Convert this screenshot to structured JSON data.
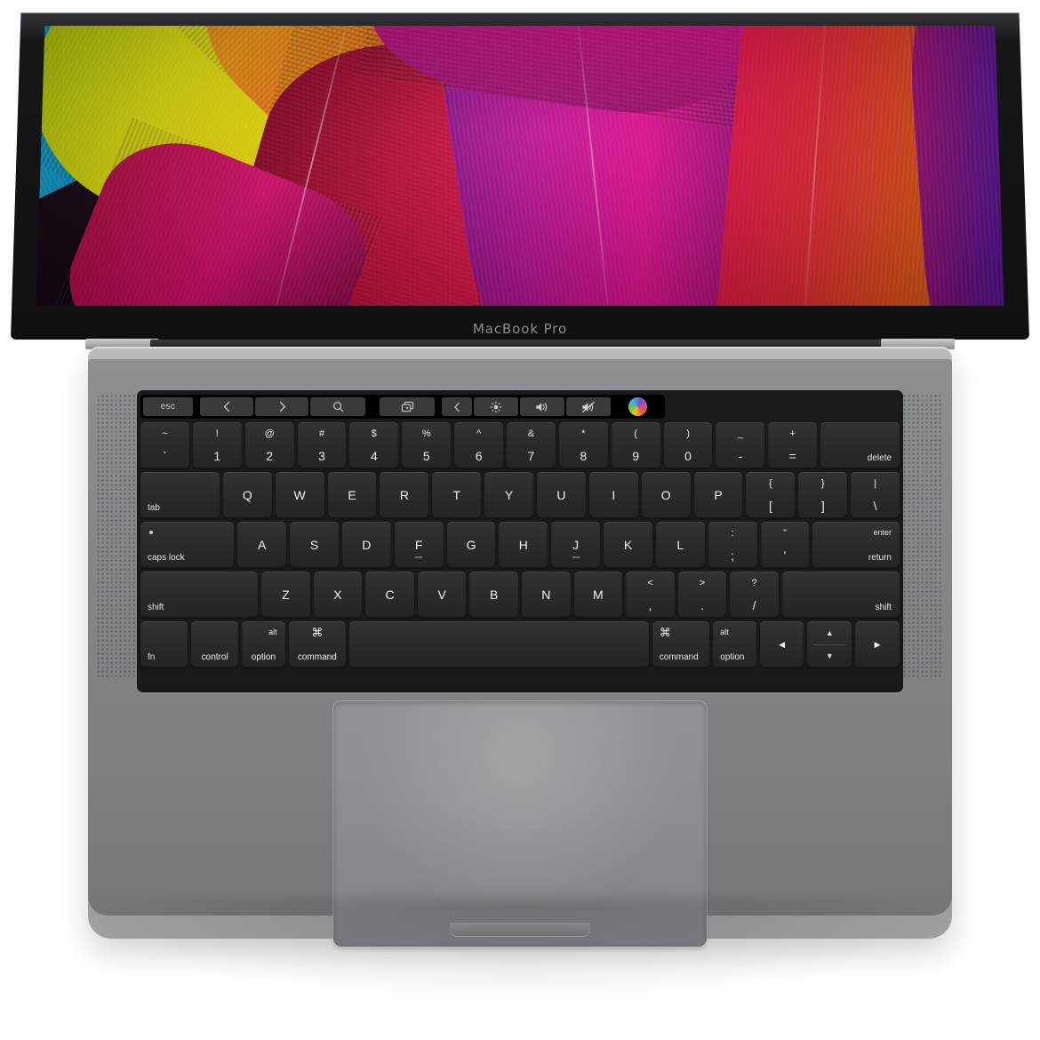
{
  "device": {
    "brand_label": "MacBook Pro",
    "finish_color": "#a8aaad",
    "keyboard_well_color": "#1a1a1c",
    "key_color": "#2b2b2d",
    "trackpad_color": "#8b8e92"
  },
  "screen": {
    "wallpaper_name": "colorful-ribbon-fibers-wallpaper",
    "palette": [
      "#14b4e6",
      "#f4e40c",
      "#f59a12",
      "#ef5a22",
      "#d9123f",
      "#e8117f",
      "#b3169b",
      "#6a1fa8"
    ]
  },
  "touchbar": {
    "esc_label": "esc",
    "back_icon": "chevron-left-icon",
    "forward_icon": "chevron-right-icon",
    "search_icon": "search-icon",
    "favorites_label": "safari-favorites-strip",
    "thumbnails": [
      "#e8453c",
      "#f2f2f4",
      "#e6e0d6",
      "#e9118b",
      "#f6f6f8",
      "#ffffff",
      "#2d2150",
      "#ffffff"
    ],
    "tabs_overview_icon": "window-tabs-icon",
    "expand_icon": "chevron-left-icon",
    "brightness_icon": "brightness-icon",
    "volume_icon": "volume-up-icon",
    "mute_icon": "volume-mute-icon",
    "siri_icon": "siri-color-wheel-icon"
  },
  "keyboard": {
    "rows": [
      {
        "name": "number-row",
        "keys": [
          {
            "name": "key-backtick",
            "top": "~",
            "bottom": "`",
            "style": "stacked",
            "width": "w-key"
          },
          {
            "name": "key-1",
            "top": "!",
            "bottom": "1",
            "style": "stacked",
            "width": "w-key"
          },
          {
            "name": "key-2",
            "top": "@",
            "bottom": "2",
            "style": "stacked",
            "width": "w-key"
          },
          {
            "name": "key-3",
            "top": "#",
            "bottom": "3",
            "style": "stacked",
            "width": "w-key"
          },
          {
            "name": "key-4",
            "top": "$",
            "bottom": "4",
            "style": "stacked",
            "width": "w-key"
          },
          {
            "name": "key-5",
            "top": "%",
            "bottom": "5",
            "style": "stacked",
            "width": "w-key"
          },
          {
            "name": "key-6",
            "top": "^",
            "bottom": "6",
            "style": "stacked",
            "width": "w-key"
          },
          {
            "name": "key-7",
            "top": "&",
            "bottom": "7",
            "style": "stacked",
            "width": "w-key"
          },
          {
            "name": "key-8",
            "top": "*",
            "bottom": "8",
            "style": "stacked",
            "width": "w-key"
          },
          {
            "name": "key-9",
            "top": "(",
            "bottom": "9",
            "style": "stacked",
            "width": "w-key"
          },
          {
            "name": "key-0",
            "top": ")",
            "bottom": "0",
            "style": "stacked",
            "width": "w-key"
          },
          {
            "name": "key-minus",
            "top": "_",
            "bottom": "-",
            "style": "stacked",
            "width": "w-key"
          },
          {
            "name": "key-equals",
            "top": "+",
            "bottom": "=",
            "style": "stacked",
            "width": "w-key"
          },
          {
            "name": "key-delete",
            "label": "delete",
            "style": "corner-br",
            "width": "w-del"
          }
        ]
      },
      {
        "name": "qwerty-row",
        "keys": [
          {
            "name": "key-tab",
            "label": "tab",
            "style": "corner-bl",
            "width": "w-tab"
          },
          {
            "name": "key-q",
            "label": "Q",
            "style": "single",
            "width": "w-key"
          },
          {
            "name": "key-w",
            "label": "W",
            "style": "single",
            "width": "w-key"
          },
          {
            "name": "key-e",
            "label": "E",
            "style": "single",
            "width": "w-key"
          },
          {
            "name": "key-r",
            "label": "R",
            "style": "single",
            "width": "w-key"
          },
          {
            "name": "key-t",
            "label": "T",
            "style": "single",
            "width": "w-key"
          },
          {
            "name": "key-y",
            "label": "Y",
            "style": "single",
            "width": "w-key"
          },
          {
            "name": "key-u",
            "label": "U",
            "style": "single",
            "width": "w-key"
          },
          {
            "name": "key-i",
            "label": "I",
            "style": "single",
            "width": "w-key"
          },
          {
            "name": "key-o",
            "label": "O",
            "style": "single",
            "width": "w-key"
          },
          {
            "name": "key-p",
            "label": "P",
            "style": "single",
            "width": "w-key"
          },
          {
            "name": "key-bracket-left",
            "top": "{",
            "bottom": "[",
            "style": "stacked",
            "width": "w-key"
          },
          {
            "name": "key-bracket-right",
            "top": "}",
            "bottom": "]",
            "style": "stacked",
            "width": "w-key"
          },
          {
            "name": "key-backslash",
            "top": "|",
            "bottom": "\\",
            "style": "stacked",
            "width": "w-key"
          }
        ]
      },
      {
        "name": "home-row",
        "keys": [
          {
            "name": "key-caps-lock",
            "label": "caps lock",
            "style": "caps",
            "width": "w-caps"
          },
          {
            "name": "key-a",
            "label": "A",
            "style": "single",
            "width": "w-key"
          },
          {
            "name": "key-s",
            "label": "S",
            "style": "single",
            "width": "w-key"
          },
          {
            "name": "key-d",
            "label": "D",
            "style": "single",
            "width": "w-key"
          },
          {
            "name": "key-f",
            "label": "F",
            "style": "single-bump",
            "width": "w-key"
          },
          {
            "name": "key-g",
            "label": "G",
            "style": "single",
            "width": "w-key"
          },
          {
            "name": "key-h",
            "label": "H",
            "style": "single",
            "width": "w-key"
          },
          {
            "name": "key-j",
            "label": "J",
            "style": "single-bump",
            "width": "w-key"
          },
          {
            "name": "key-k",
            "label": "K",
            "style": "single",
            "width": "w-key"
          },
          {
            "name": "key-l",
            "label": "L",
            "style": "single",
            "width": "w-key"
          },
          {
            "name": "key-semicolon",
            "top": ":",
            "bottom": ";",
            "style": "stacked",
            "width": "w-key"
          },
          {
            "name": "key-quote",
            "top": "”",
            "bottom": "’",
            "style": "stacked",
            "width": "w-key"
          },
          {
            "name": "key-return",
            "top": "enter",
            "bottom": "return",
            "style": "corner-tr-br",
            "width": "w-ret"
          }
        ]
      },
      {
        "name": "shift-row",
        "keys": [
          {
            "name": "key-shift-left",
            "label": "shift",
            "style": "corner-bl",
            "width": "w-lsh"
          },
          {
            "name": "key-z",
            "label": "Z",
            "style": "single",
            "width": "w-key"
          },
          {
            "name": "key-x",
            "label": "X",
            "style": "single",
            "width": "w-key"
          },
          {
            "name": "key-c",
            "label": "C",
            "style": "single",
            "width": "w-key"
          },
          {
            "name": "key-v",
            "label": "V",
            "style": "single",
            "width": "w-key"
          },
          {
            "name": "key-b",
            "label": "B",
            "style": "single",
            "width": "w-key"
          },
          {
            "name": "key-n",
            "label": "N",
            "style": "single",
            "width": "w-key"
          },
          {
            "name": "key-m",
            "label": "M",
            "style": "single",
            "width": "w-key"
          },
          {
            "name": "key-comma",
            "top": "<",
            "bottom": ",",
            "style": "stacked",
            "width": "w-key"
          },
          {
            "name": "key-period",
            "top": ">",
            "bottom": ".",
            "style": "stacked",
            "width": "w-key"
          },
          {
            "name": "key-slash",
            "top": "?",
            "bottom": "/",
            "style": "stacked",
            "width": "w-key"
          },
          {
            "name": "key-shift-right",
            "label": "shift",
            "style": "corner-br",
            "width": "w-rsh"
          }
        ]
      },
      {
        "name": "modifier-row",
        "keys": [
          {
            "name": "key-fn",
            "label": "fn",
            "style": "corner-bl",
            "width": "w-fn"
          },
          {
            "name": "key-control",
            "label": "control",
            "style": "ctr-bot",
            "width": "w-ctrl"
          },
          {
            "name": "key-option-left",
            "top": "alt",
            "bottom": "option",
            "style": "alt-right",
            "width": "w-opt"
          },
          {
            "name": "key-command-left",
            "top": "⌘",
            "bottom": "command",
            "style": "cmd",
            "width": "w-cmd"
          },
          {
            "name": "key-space",
            "label": "",
            "style": "blank",
            "width": "w-space"
          },
          {
            "name": "key-command-right",
            "top": "⌘",
            "bottom": "command",
            "style": "cmd-left",
            "width": "w-cmd"
          },
          {
            "name": "key-option-right",
            "top": "alt",
            "bottom": "option",
            "style": "alt-left",
            "width": "w-opt"
          },
          {
            "name": "key-arrow-left",
            "label": "◀",
            "style": "arrow",
            "width": "w-arrow"
          },
          {
            "name": "key-arrow-updown",
            "top": "▲",
            "bottom": "▼",
            "style": "arrow-split",
            "width": "w-arrow"
          },
          {
            "name": "key-arrow-right",
            "label": "▶",
            "style": "arrow",
            "width": "w-arrow"
          }
        ]
      }
    ]
  }
}
